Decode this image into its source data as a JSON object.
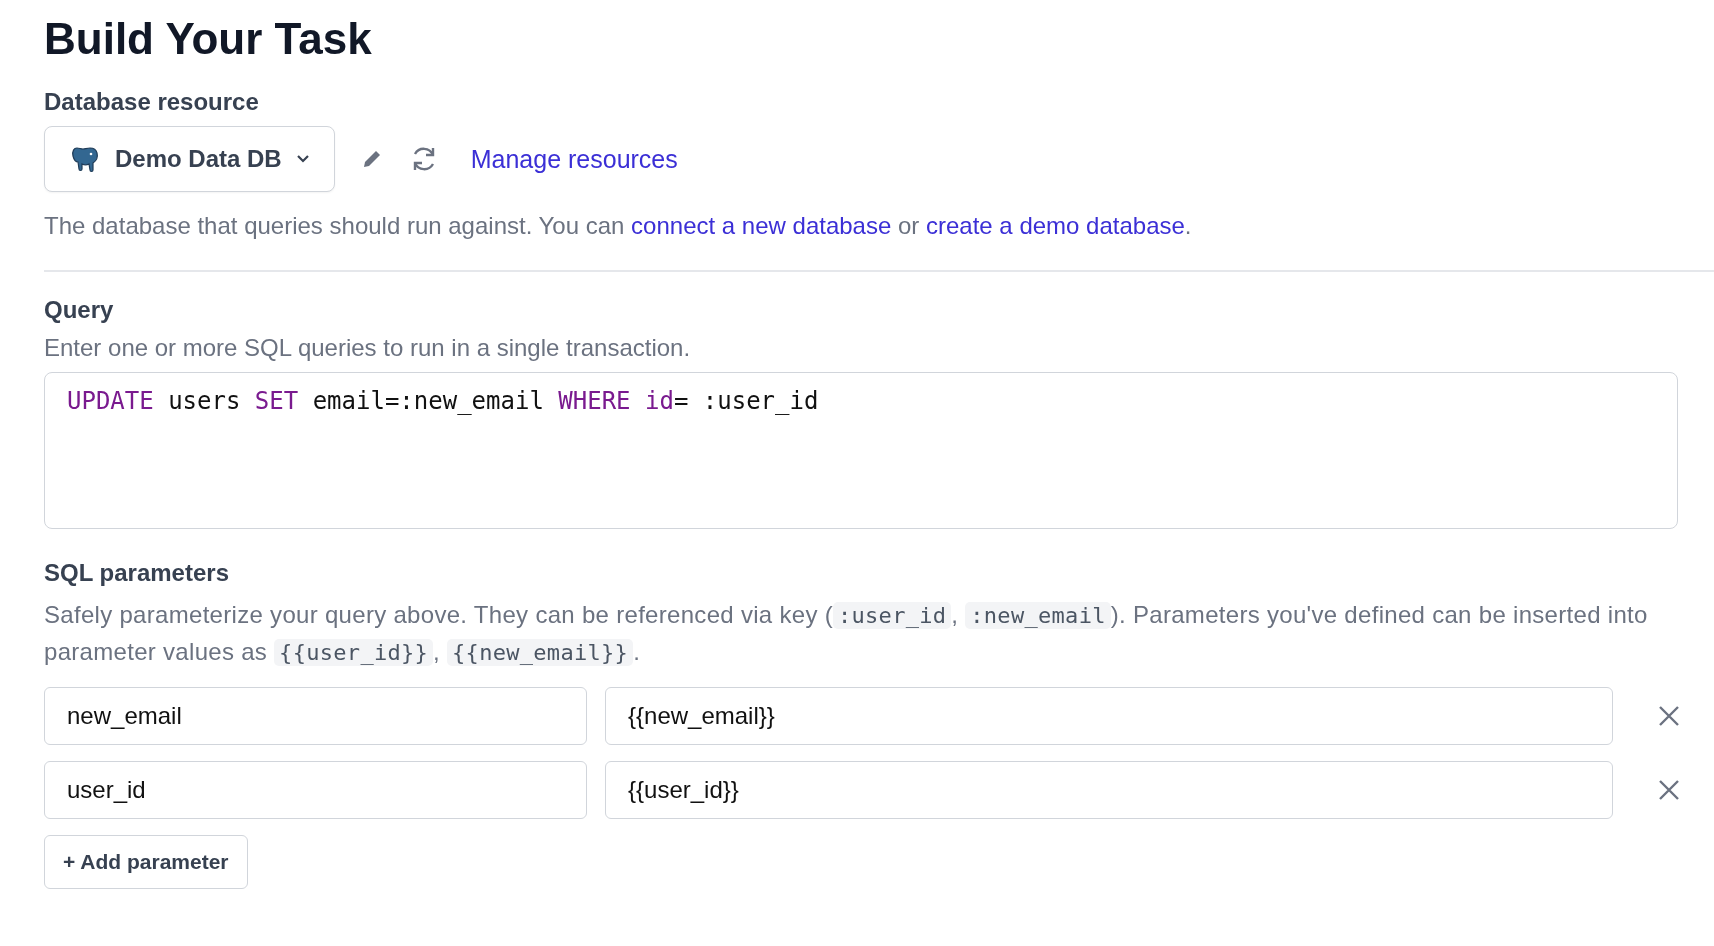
{
  "title": "Build Your Task",
  "database": {
    "label": "Database resource",
    "selected": "Demo Data DB",
    "manage_link": "Manage resources",
    "description": [
      {
        "kind": "text",
        "text": "The database that queries should run against. You can "
      },
      {
        "kind": "link",
        "text": "connect a new database"
      },
      {
        "kind": "text",
        "text": " or "
      },
      {
        "kind": "link",
        "text": "create a demo database"
      },
      {
        "kind": "text",
        "text": "."
      }
    ]
  },
  "query": {
    "label": "Query",
    "description": "Enter one or more SQL queries to run in a single transaction.",
    "code": [
      {
        "kind": "keyword",
        "text": "UPDATE"
      },
      {
        "kind": "plain",
        "text": " users "
      },
      {
        "kind": "keyword",
        "text": "SET"
      },
      {
        "kind": "plain",
        "text": " email=:new_email "
      },
      {
        "kind": "keyword",
        "text": "WHERE id"
      },
      {
        "kind": "plain",
        "text": "= :user_id"
      }
    ]
  },
  "parameters": {
    "label": "SQL parameters",
    "description": [
      {
        "kind": "text",
        "text": "Safely parameterize your query above. They can be referenced via key ("
      },
      {
        "kind": "code",
        "text": ":user_id"
      },
      {
        "kind": "text",
        "text": ", "
      },
      {
        "kind": "code",
        "text": ":new_email"
      },
      {
        "kind": "text",
        "text": "). Parameters you've defined can be inserted into parameter values as "
      },
      {
        "kind": "code",
        "text": "{{user_id}}"
      },
      {
        "kind": "text",
        "text": ", "
      },
      {
        "kind": "code",
        "text": "{{new_email}}"
      },
      {
        "kind": "text",
        "text": "."
      }
    ],
    "rows": [
      {
        "name": "new_email",
        "value": "{{new_email}}"
      },
      {
        "name": "user_id",
        "value": "{{user_id}}"
      }
    ],
    "add_button": "+ Add parameter"
  }
}
